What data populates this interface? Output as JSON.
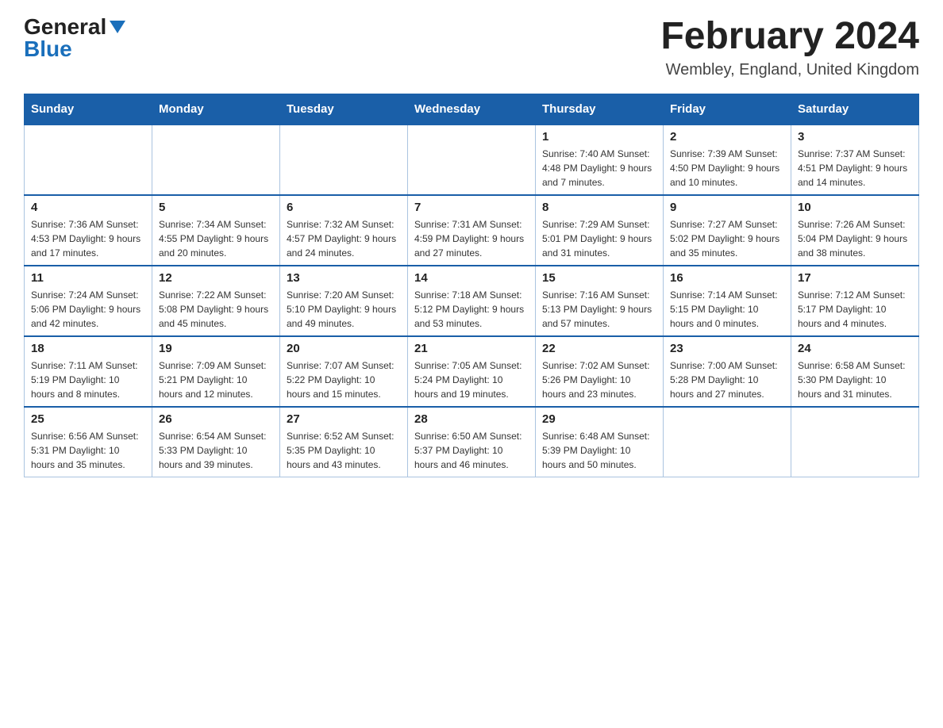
{
  "header": {
    "logo_general": "General",
    "logo_blue": "Blue",
    "main_title": "February 2024",
    "subtitle": "Wembley, England, United Kingdom"
  },
  "calendar": {
    "days_of_week": [
      "Sunday",
      "Monday",
      "Tuesday",
      "Wednesday",
      "Thursday",
      "Friday",
      "Saturday"
    ],
    "weeks": [
      [
        {
          "day": "",
          "info": ""
        },
        {
          "day": "",
          "info": ""
        },
        {
          "day": "",
          "info": ""
        },
        {
          "day": "",
          "info": ""
        },
        {
          "day": "1",
          "info": "Sunrise: 7:40 AM\nSunset: 4:48 PM\nDaylight: 9 hours and 7 minutes."
        },
        {
          "day": "2",
          "info": "Sunrise: 7:39 AM\nSunset: 4:50 PM\nDaylight: 9 hours and 10 minutes."
        },
        {
          "day": "3",
          "info": "Sunrise: 7:37 AM\nSunset: 4:51 PM\nDaylight: 9 hours and 14 minutes."
        }
      ],
      [
        {
          "day": "4",
          "info": "Sunrise: 7:36 AM\nSunset: 4:53 PM\nDaylight: 9 hours and 17 minutes."
        },
        {
          "day": "5",
          "info": "Sunrise: 7:34 AM\nSunset: 4:55 PM\nDaylight: 9 hours and 20 minutes."
        },
        {
          "day": "6",
          "info": "Sunrise: 7:32 AM\nSunset: 4:57 PM\nDaylight: 9 hours and 24 minutes."
        },
        {
          "day": "7",
          "info": "Sunrise: 7:31 AM\nSunset: 4:59 PM\nDaylight: 9 hours and 27 minutes."
        },
        {
          "day": "8",
          "info": "Sunrise: 7:29 AM\nSunset: 5:01 PM\nDaylight: 9 hours and 31 minutes."
        },
        {
          "day": "9",
          "info": "Sunrise: 7:27 AM\nSunset: 5:02 PM\nDaylight: 9 hours and 35 minutes."
        },
        {
          "day": "10",
          "info": "Sunrise: 7:26 AM\nSunset: 5:04 PM\nDaylight: 9 hours and 38 minutes."
        }
      ],
      [
        {
          "day": "11",
          "info": "Sunrise: 7:24 AM\nSunset: 5:06 PM\nDaylight: 9 hours and 42 minutes."
        },
        {
          "day": "12",
          "info": "Sunrise: 7:22 AM\nSunset: 5:08 PM\nDaylight: 9 hours and 45 minutes."
        },
        {
          "day": "13",
          "info": "Sunrise: 7:20 AM\nSunset: 5:10 PM\nDaylight: 9 hours and 49 minutes."
        },
        {
          "day": "14",
          "info": "Sunrise: 7:18 AM\nSunset: 5:12 PM\nDaylight: 9 hours and 53 minutes."
        },
        {
          "day": "15",
          "info": "Sunrise: 7:16 AM\nSunset: 5:13 PM\nDaylight: 9 hours and 57 minutes."
        },
        {
          "day": "16",
          "info": "Sunrise: 7:14 AM\nSunset: 5:15 PM\nDaylight: 10 hours and 0 minutes."
        },
        {
          "day": "17",
          "info": "Sunrise: 7:12 AM\nSunset: 5:17 PM\nDaylight: 10 hours and 4 minutes."
        }
      ],
      [
        {
          "day": "18",
          "info": "Sunrise: 7:11 AM\nSunset: 5:19 PM\nDaylight: 10 hours and 8 minutes."
        },
        {
          "day": "19",
          "info": "Sunrise: 7:09 AM\nSunset: 5:21 PM\nDaylight: 10 hours and 12 minutes."
        },
        {
          "day": "20",
          "info": "Sunrise: 7:07 AM\nSunset: 5:22 PM\nDaylight: 10 hours and 15 minutes."
        },
        {
          "day": "21",
          "info": "Sunrise: 7:05 AM\nSunset: 5:24 PM\nDaylight: 10 hours and 19 minutes."
        },
        {
          "day": "22",
          "info": "Sunrise: 7:02 AM\nSunset: 5:26 PM\nDaylight: 10 hours and 23 minutes."
        },
        {
          "day": "23",
          "info": "Sunrise: 7:00 AM\nSunset: 5:28 PM\nDaylight: 10 hours and 27 minutes."
        },
        {
          "day": "24",
          "info": "Sunrise: 6:58 AM\nSunset: 5:30 PM\nDaylight: 10 hours and 31 minutes."
        }
      ],
      [
        {
          "day": "25",
          "info": "Sunrise: 6:56 AM\nSunset: 5:31 PM\nDaylight: 10 hours and 35 minutes."
        },
        {
          "day": "26",
          "info": "Sunrise: 6:54 AM\nSunset: 5:33 PM\nDaylight: 10 hours and 39 minutes."
        },
        {
          "day": "27",
          "info": "Sunrise: 6:52 AM\nSunset: 5:35 PM\nDaylight: 10 hours and 43 minutes."
        },
        {
          "day": "28",
          "info": "Sunrise: 6:50 AM\nSunset: 5:37 PM\nDaylight: 10 hours and 46 minutes."
        },
        {
          "day": "29",
          "info": "Sunrise: 6:48 AM\nSunset: 5:39 PM\nDaylight: 10 hours and 50 minutes."
        },
        {
          "day": "",
          "info": ""
        },
        {
          "day": "",
          "info": ""
        }
      ]
    ]
  }
}
